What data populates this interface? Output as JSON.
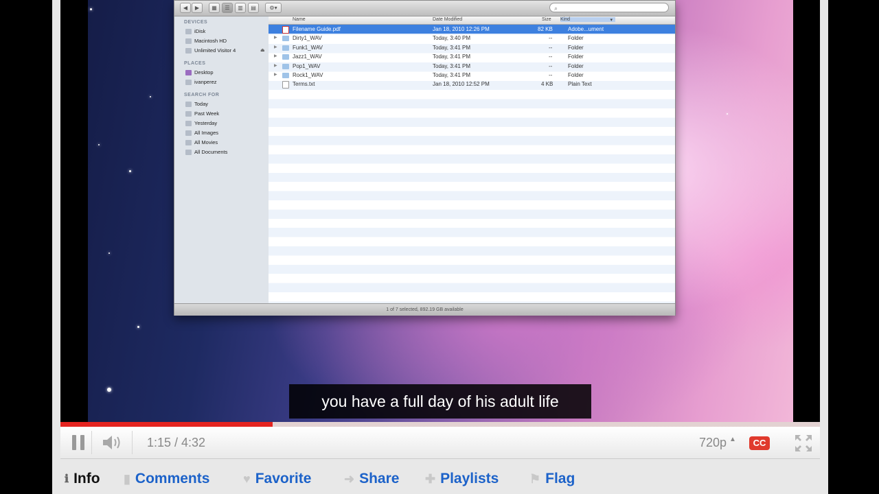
{
  "finder": {
    "sidebar": {
      "devices_header": "DEVICES",
      "devices": [
        "iDisk",
        "Macintosh HD",
        "Unlimited Visitor 4"
      ],
      "places_header": "PLACES",
      "places": [
        "Desktop",
        "ivanperez"
      ],
      "search_header": "SEARCH FOR",
      "searches": [
        "Today",
        "Past Week",
        "Yesterday",
        "All Images",
        "All Movies",
        "All Documents"
      ]
    },
    "columns": {
      "name": "Name",
      "date": "Date Modified",
      "size": "Size",
      "kind": "Kind"
    },
    "files": [
      {
        "name": "Filename Guide.pdf",
        "date": "Jan 18, 2010 12:26 PM",
        "size": "82 KB",
        "kind": "Adobe...ument",
        "type": "pdf",
        "selected": true
      },
      {
        "name": "Dirty1_WAV",
        "date": "Today, 3:40 PM",
        "size": "--",
        "kind": "Folder",
        "type": "folder",
        "selected": false
      },
      {
        "name": "Funk1_WAV",
        "date": "Today, 3:41 PM",
        "size": "--",
        "kind": "Folder",
        "type": "folder",
        "selected": false
      },
      {
        "name": "Jazz1_WAV",
        "date": "Today, 3:41 PM",
        "size": "--",
        "kind": "Folder",
        "type": "folder",
        "selected": false
      },
      {
        "name": "Pop1_WAV",
        "date": "Today, 3:41 PM",
        "size": "--",
        "kind": "Folder",
        "type": "folder",
        "selected": false
      },
      {
        "name": "Rock1_WAV",
        "date": "Today, 3:41 PM",
        "size": "--",
        "kind": "Folder",
        "type": "folder",
        "selected": false
      },
      {
        "name": "Terms.txt",
        "date": "Jan 18, 2010 12:52 PM",
        "size": "4 KB",
        "kind": "Plain Text",
        "type": "doc",
        "selected": false
      }
    ],
    "status": "1 of 7 selected, 892.19 GB available"
  },
  "caption": "you have a full day of his adult life",
  "player": {
    "progress_fraction": 0.279,
    "time": "1:15 / 4:32",
    "quality": "720p",
    "cc_label": "CC",
    "colors": {
      "progress": "#e52420",
      "cc": "#e03a2d"
    }
  },
  "tabs": {
    "info": "Info",
    "comments": "Comments",
    "favorite": "Favorite",
    "share": "Share",
    "playlists": "Playlists",
    "flag": "Flag"
  }
}
